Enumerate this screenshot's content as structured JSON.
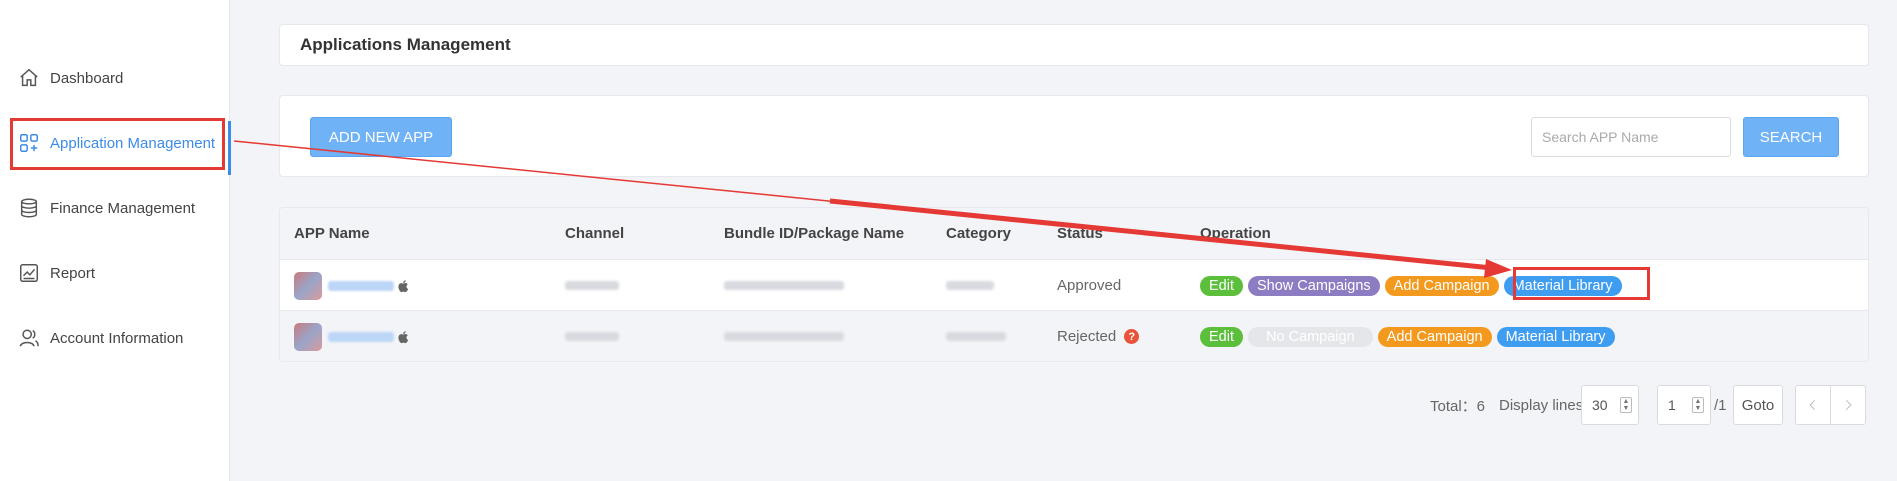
{
  "sidebar": {
    "items": [
      {
        "label": "Dashboard",
        "icon": "home-icon"
      },
      {
        "label": "Application Management",
        "icon": "grid-icon",
        "active": true
      },
      {
        "label": "Finance Management",
        "icon": "database-icon"
      },
      {
        "label": "Report",
        "icon": "chart-icon"
      },
      {
        "label": "Account Information",
        "icon": "user-icon"
      }
    ]
  },
  "header": {
    "title": "Applications Management"
  },
  "toolbar": {
    "add_label": "ADD NEW APP",
    "search_placeholder": "Search APP Name",
    "search_label": "SEARCH"
  },
  "table": {
    "columns": [
      "APP Name",
      "Channel",
      "Bundle ID/Package Name",
      "Category",
      "Status",
      "Operation"
    ],
    "rows": [
      {
        "status": "Approved",
        "operations": [
          "Edit",
          "Show Campaigns",
          "Add Campaign",
          "Material Library"
        ]
      },
      {
        "status": "Rejected",
        "status_hint": "?",
        "operations": [
          "Edit",
          "No Campaign",
          "Add Campaign",
          "Material Library"
        ]
      }
    ]
  },
  "pagination": {
    "total_label": "Total：6",
    "display_lines_label": "Display lines",
    "display_lines_value": "30",
    "page_value": "1",
    "page_total": "/1",
    "goto_label": "Goto"
  },
  "colors": {
    "accent": "#3c8be8",
    "primary_button": "#6fb2f5",
    "edit_tag": "#5bbf3b",
    "show_campaigns_tag": "#8e7cc3",
    "add_campaign_tag": "#f39a1e",
    "material_library_tag": "#3e9df1",
    "annotation": "#e53935"
  }
}
